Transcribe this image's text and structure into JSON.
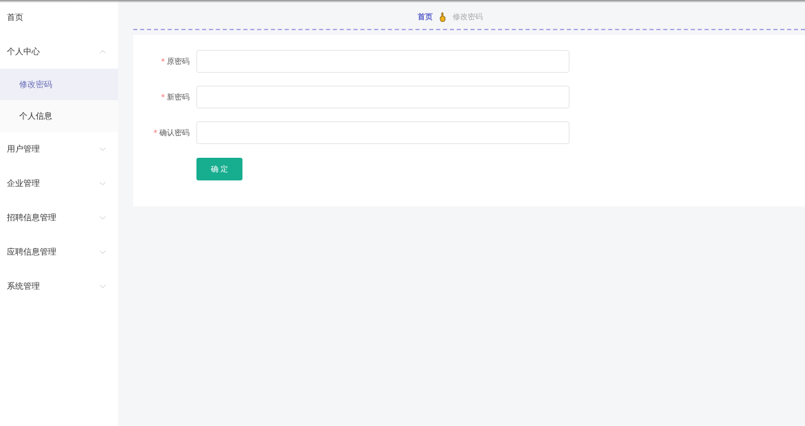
{
  "sidebar": {
    "items": [
      {
        "kind": "link",
        "label": "首页"
      },
      {
        "kind": "group",
        "label": "个人中心",
        "expanded": true,
        "children": [
          {
            "label": "修改密码",
            "selected": true
          },
          {
            "label": "个人信息",
            "selected": false
          }
        ]
      },
      {
        "kind": "group",
        "label": "用户管理",
        "expanded": false
      },
      {
        "kind": "group",
        "label": "企业管理",
        "expanded": false
      },
      {
        "kind": "group",
        "label": "招聘信息管理",
        "expanded": false
      },
      {
        "kind": "group",
        "label": "应聘信息管理",
        "expanded": false
      },
      {
        "kind": "group",
        "label": "系统管理",
        "expanded": false
      }
    ]
  },
  "breadcrumb": [
    {
      "label": "首页",
      "current": false
    },
    {
      "label": "修改密码",
      "current": true
    }
  ],
  "form": {
    "fields": [
      {
        "marker": "*",
        "label": "原密码"
      },
      {
        "marker": "*",
        "label": "新密码"
      },
      {
        "marker": "*",
        "label": "确认密码"
      }
    ],
    "submit": "确 定"
  }
}
